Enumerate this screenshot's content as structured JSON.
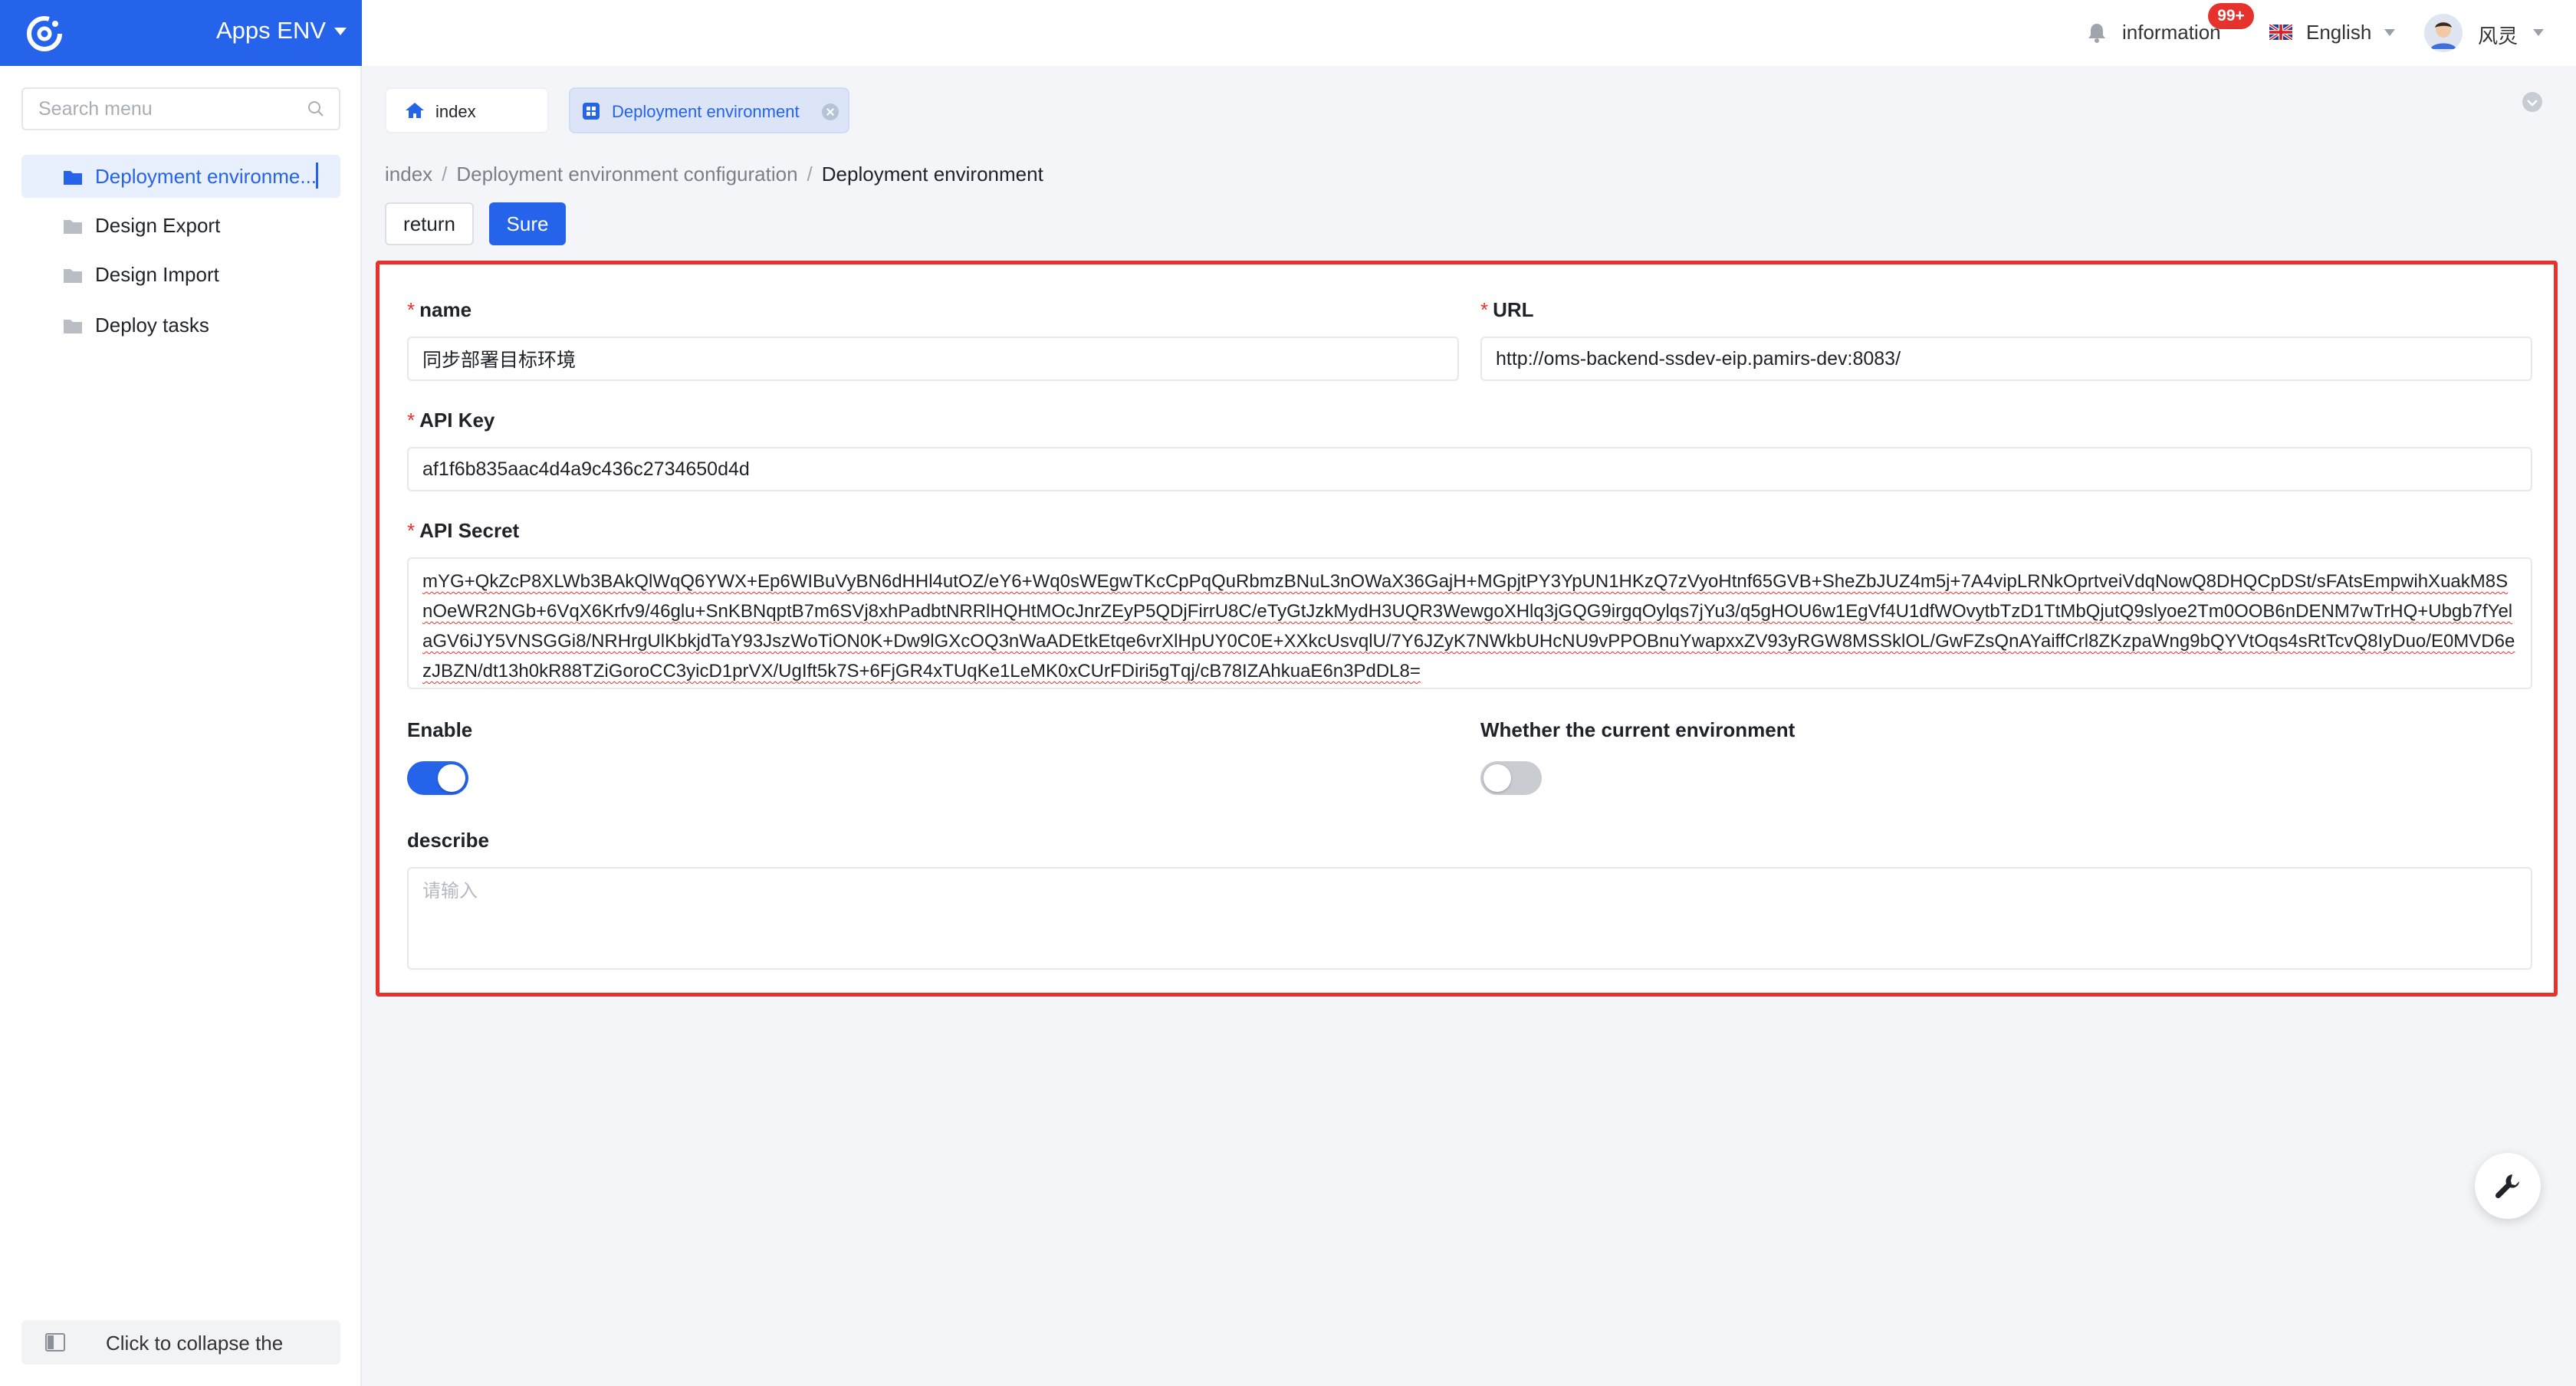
{
  "app": {
    "name": "Apps ENV"
  },
  "sidebar": {
    "search_placeholder": "Search menu",
    "items": [
      {
        "label": "Deployment environme..."
      },
      {
        "label": "Design Export"
      },
      {
        "label": "Design Import"
      },
      {
        "label": "Deploy tasks"
      }
    ],
    "collapse_label": "Click to collapse the"
  },
  "header": {
    "notifications_label": "information",
    "notifications_badge": "99+",
    "language": "English",
    "user_name": "风灵"
  },
  "tabs": [
    {
      "label": "index"
    },
    {
      "label": "Deployment environment"
    }
  ],
  "breadcrumb": {
    "items": [
      "index",
      "Deployment environment configuration",
      "Deployment environment"
    ],
    "separator": "/"
  },
  "actions": {
    "return_label": "return",
    "sure_label": "Sure"
  },
  "form": {
    "name": {
      "label": "name",
      "value": "同步部署目标环境"
    },
    "url": {
      "label": "URL",
      "value": "http://oms-backend-ssdev-eip.pamirs-dev:8083/"
    },
    "api_key": {
      "label": "API Key",
      "value": "af1f6b835aac4d4a9c436c2734650d4d"
    },
    "api_secret": {
      "label": "API Secret",
      "value": "mYG+QkZcP8XLWb3BAkQlWqQ6YWX+Ep6WIBuVyBN6dHHl4utOZ/eY6+Wq0sWEgwTKcCpPqQuRbmzBNuL3nOWaX36GajH+MGpjtPY3YpUN1HKzQ7zVyoHtnf65GVB+SheZbJUZ4m5j+7A4vipLRNkOprtveiVdqNowQ8DHQCpDSt/sFAtsEmpwihXuakM8SnOeWR2NGb+6VqX6Krfv9/46glu+SnKBNqptB7m6SVj8xhPadbtNRRlHQHtMOcJnrZEyP5QDjFirrU8C/eTyGtJzkMydH3UQR3WewgoXHlq3jGQG9irgqOylqs7jYu3/q5gHOU6w1EgVf4U1dfWOvytbTzD1TtMbQjutQ9slyoe2Tm0OOB6nDENM7wTrHQ+Ubgb7fYelaGV6iJY5VNSGGi8/NRHrgUlKbkjdTaY93JszWoTiON0K+Dw9lGXcOQ3nWaADEtkEtqe6vrXlHpUY0C0E+XXkcUsvqlU/7Y6JZyK7NWkbUHcNU9vPPOBnuYwapxxZV93yRGW8MSSklOL/GwFZsQnAYaiffCrl8ZKzpaWng9bQYVtOqs4sRtTcvQ8IyDuo/E0MVD6ezJBZN/dt13h0kR88TZiGoroCC3yicD1prVX/UgIft5k7S+6FjGR4xTUqKe1LeMK0xCUrFDiri5gTqj/cB78IZAhkuaE6n3PdDL8="
    },
    "enable": {
      "label": "Enable",
      "on": true
    },
    "current_env": {
      "label": "Whether the current environment",
      "on": false
    },
    "describe": {
      "label": "describe",
      "placeholder": "请输入",
      "value": ""
    }
  },
  "colors": {
    "brand": "#2563eb",
    "highlight_border": "#e5322d",
    "badge": "#e5322d"
  },
  "icons": [
    "logo-icon",
    "search-icon",
    "folder-icon",
    "collapse-icon",
    "bell-icon",
    "uk-flag-icon",
    "avatar-icon",
    "home-icon",
    "grid-icon",
    "close-icon",
    "chevron-down-circle-icon",
    "wrench-icon"
  ]
}
